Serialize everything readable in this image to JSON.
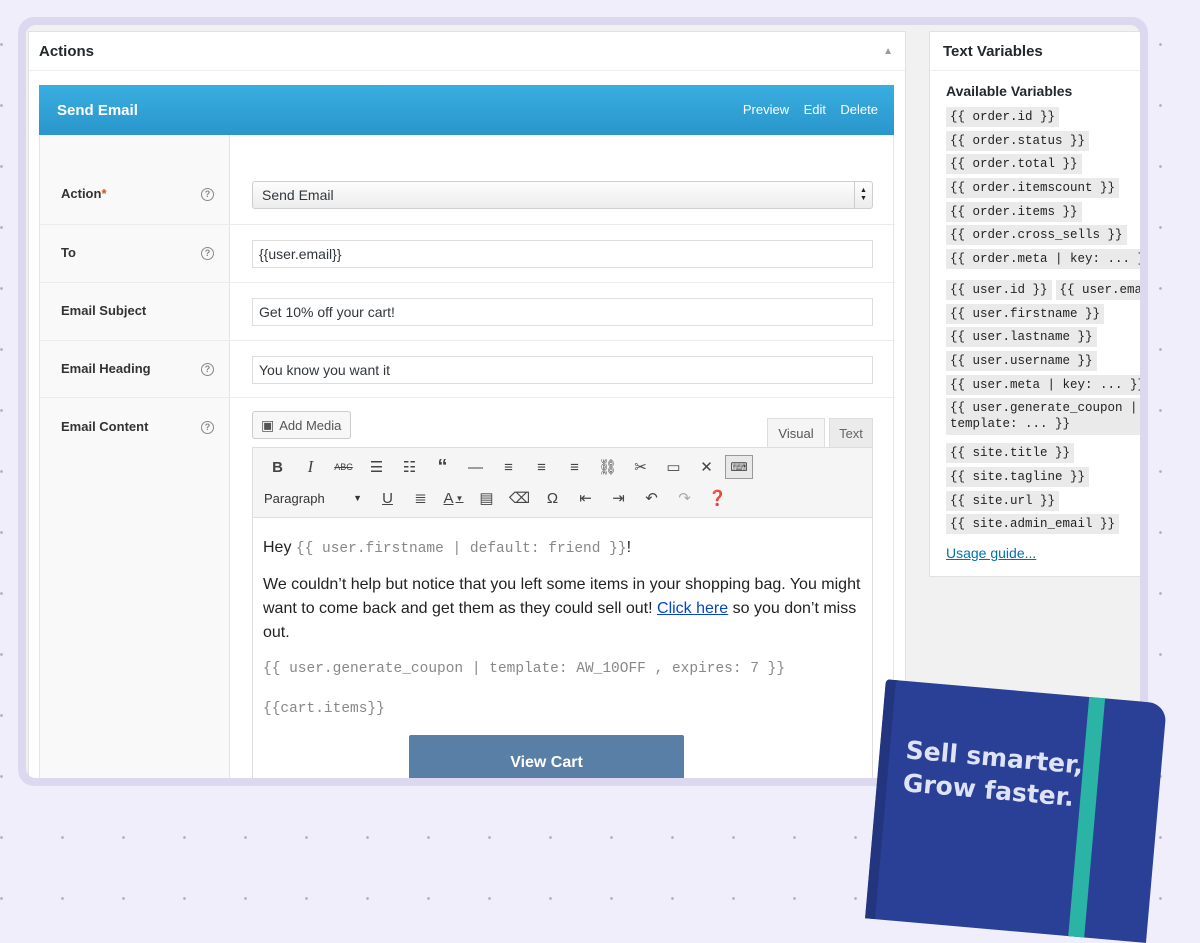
{
  "actions": {
    "title": "Actions",
    "send_email": {
      "title": "Send Email",
      "links": [
        "Preview",
        "Edit",
        "Delete"
      ]
    },
    "fields": {
      "action_label": "Action",
      "action_required": "*",
      "action_value": "Send Email",
      "to_label": "To",
      "to_value": "{{user.email}}",
      "subject_label": "Email Subject",
      "subject_value": "Get 10% off your cart!",
      "heading_label": "Email Heading",
      "heading_value": "You know you want it",
      "content_label": "Email Content"
    },
    "editor": {
      "add_media": "Add Media",
      "tabs": [
        "Visual",
        "Text"
      ],
      "format_select": "Paragraph",
      "content": {
        "greeting": "Hey",
        "greeting_var": "{{ user.firstname | default: friend }}",
        "greeting_end": "!",
        "para_before_link": "We couldn’t help but notice that you left some items in your shopping bag. You might want to come back and get them as they could sell out!",
        "link": "Click here",
        "para_after_link": "so you don’t miss out.",
        "coupon_var": "{{ user.generate_coupon | template: AW_10OFF , expires: 7 }}",
        "cart_var": "{{cart.items}}",
        "button": "View Cart"
      }
    }
  },
  "text_variables": {
    "title": "Text Variables",
    "subtitle": "Available Variables",
    "order_vars": [
      "{{ order.id }}",
      "{{ order.status }}",
      "{{ order.total }}",
      "{{ order.itemscount }}",
      "{{ order.items }}",
      "{{ order.cross_sells }}",
      "{{ order.meta | key: ... }}"
    ],
    "user_vars_inline": [
      "{{ user.id }}",
      "{{ user.email }}"
    ],
    "user_vars": [
      "{{ user.firstname }}",
      "{{ user.lastname }}",
      "{{ user.username }}",
      "{{ user.meta | key: ... }}"
    ],
    "coupon_var_line1": "{{ user.generate_coupon |",
    "coupon_var_line2": "template: ... }}",
    "site_vars": [
      "{{ site.title }}",
      "{{ site.tagline }}",
      "{{ site.url }}",
      "{{ site.admin_email }}"
    ],
    "usage_link": "Usage guide..."
  },
  "notebook": {
    "line1": "Sell smarter,",
    "line2": "Grow faster."
  },
  "colors": {
    "header_blue": "#2ea2d8",
    "button_blue": "#5a7fa6",
    "notebook_blue": "#2a3f96",
    "notebook_band": "#2bb3a6",
    "background": "#f0eefb"
  }
}
